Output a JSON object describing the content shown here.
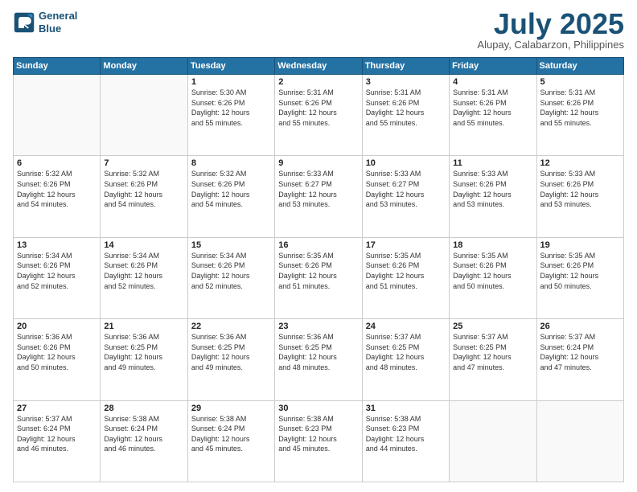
{
  "header": {
    "logo_line1": "General",
    "logo_line2": "Blue",
    "month_year": "July 2025",
    "location": "Alupay, Calabarzon, Philippines"
  },
  "weekdays": [
    "Sunday",
    "Monday",
    "Tuesday",
    "Wednesday",
    "Thursday",
    "Friday",
    "Saturday"
  ],
  "weeks": [
    [
      {
        "day": "",
        "info": ""
      },
      {
        "day": "",
        "info": ""
      },
      {
        "day": "1",
        "info": "Sunrise: 5:30 AM\nSunset: 6:26 PM\nDaylight: 12 hours\nand 55 minutes."
      },
      {
        "day": "2",
        "info": "Sunrise: 5:31 AM\nSunset: 6:26 PM\nDaylight: 12 hours\nand 55 minutes."
      },
      {
        "day": "3",
        "info": "Sunrise: 5:31 AM\nSunset: 6:26 PM\nDaylight: 12 hours\nand 55 minutes."
      },
      {
        "day": "4",
        "info": "Sunrise: 5:31 AM\nSunset: 6:26 PM\nDaylight: 12 hours\nand 55 minutes."
      },
      {
        "day": "5",
        "info": "Sunrise: 5:31 AM\nSunset: 6:26 PM\nDaylight: 12 hours\nand 55 minutes."
      }
    ],
    [
      {
        "day": "6",
        "info": "Sunrise: 5:32 AM\nSunset: 6:26 PM\nDaylight: 12 hours\nand 54 minutes."
      },
      {
        "day": "7",
        "info": "Sunrise: 5:32 AM\nSunset: 6:26 PM\nDaylight: 12 hours\nand 54 minutes."
      },
      {
        "day": "8",
        "info": "Sunrise: 5:32 AM\nSunset: 6:26 PM\nDaylight: 12 hours\nand 54 minutes."
      },
      {
        "day": "9",
        "info": "Sunrise: 5:33 AM\nSunset: 6:27 PM\nDaylight: 12 hours\nand 53 minutes."
      },
      {
        "day": "10",
        "info": "Sunrise: 5:33 AM\nSunset: 6:27 PM\nDaylight: 12 hours\nand 53 minutes."
      },
      {
        "day": "11",
        "info": "Sunrise: 5:33 AM\nSunset: 6:26 PM\nDaylight: 12 hours\nand 53 minutes."
      },
      {
        "day": "12",
        "info": "Sunrise: 5:33 AM\nSunset: 6:26 PM\nDaylight: 12 hours\nand 53 minutes."
      }
    ],
    [
      {
        "day": "13",
        "info": "Sunrise: 5:34 AM\nSunset: 6:26 PM\nDaylight: 12 hours\nand 52 minutes."
      },
      {
        "day": "14",
        "info": "Sunrise: 5:34 AM\nSunset: 6:26 PM\nDaylight: 12 hours\nand 52 minutes."
      },
      {
        "day": "15",
        "info": "Sunrise: 5:34 AM\nSunset: 6:26 PM\nDaylight: 12 hours\nand 52 minutes."
      },
      {
        "day": "16",
        "info": "Sunrise: 5:35 AM\nSunset: 6:26 PM\nDaylight: 12 hours\nand 51 minutes."
      },
      {
        "day": "17",
        "info": "Sunrise: 5:35 AM\nSunset: 6:26 PM\nDaylight: 12 hours\nand 51 minutes."
      },
      {
        "day": "18",
        "info": "Sunrise: 5:35 AM\nSunset: 6:26 PM\nDaylight: 12 hours\nand 50 minutes."
      },
      {
        "day": "19",
        "info": "Sunrise: 5:35 AM\nSunset: 6:26 PM\nDaylight: 12 hours\nand 50 minutes."
      }
    ],
    [
      {
        "day": "20",
        "info": "Sunrise: 5:36 AM\nSunset: 6:26 PM\nDaylight: 12 hours\nand 50 minutes."
      },
      {
        "day": "21",
        "info": "Sunrise: 5:36 AM\nSunset: 6:25 PM\nDaylight: 12 hours\nand 49 minutes."
      },
      {
        "day": "22",
        "info": "Sunrise: 5:36 AM\nSunset: 6:25 PM\nDaylight: 12 hours\nand 49 minutes."
      },
      {
        "day": "23",
        "info": "Sunrise: 5:36 AM\nSunset: 6:25 PM\nDaylight: 12 hours\nand 48 minutes."
      },
      {
        "day": "24",
        "info": "Sunrise: 5:37 AM\nSunset: 6:25 PM\nDaylight: 12 hours\nand 48 minutes."
      },
      {
        "day": "25",
        "info": "Sunrise: 5:37 AM\nSunset: 6:25 PM\nDaylight: 12 hours\nand 47 minutes."
      },
      {
        "day": "26",
        "info": "Sunrise: 5:37 AM\nSunset: 6:24 PM\nDaylight: 12 hours\nand 47 minutes."
      }
    ],
    [
      {
        "day": "27",
        "info": "Sunrise: 5:37 AM\nSunset: 6:24 PM\nDaylight: 12 hours\nand 46 minutes."
      },
      {
        "day": "28",
        "info": "Sunrise: 5:38 AM\nSunset: 6:24 PM\nDaylight: 12 hours\nand 46 minutes."
      },
      {
        "day": "29",
        "info": "Sunrise: 5:38 AM\nSunset: 6:24 PM\nDaylight: 12 hours\nand 45 minutes."
      },
      {
        "day": "30",
        "info": "Sunrise: 5:38 AM\nSunset: 6:23 PM\nDaylight: 12 hours\nand 45 minutes."
      },
      {
        "day": "31",
        "info": "Sunrise: 5:38 AM\nSunset: 6:23 PM\nDaylight: 12 hours\nand 44 minutes."
      },
      {
        "day": "",
        "info": ""
      },
      {
        "day": "",
        "info": ""
      }
    ]
  ]
}
